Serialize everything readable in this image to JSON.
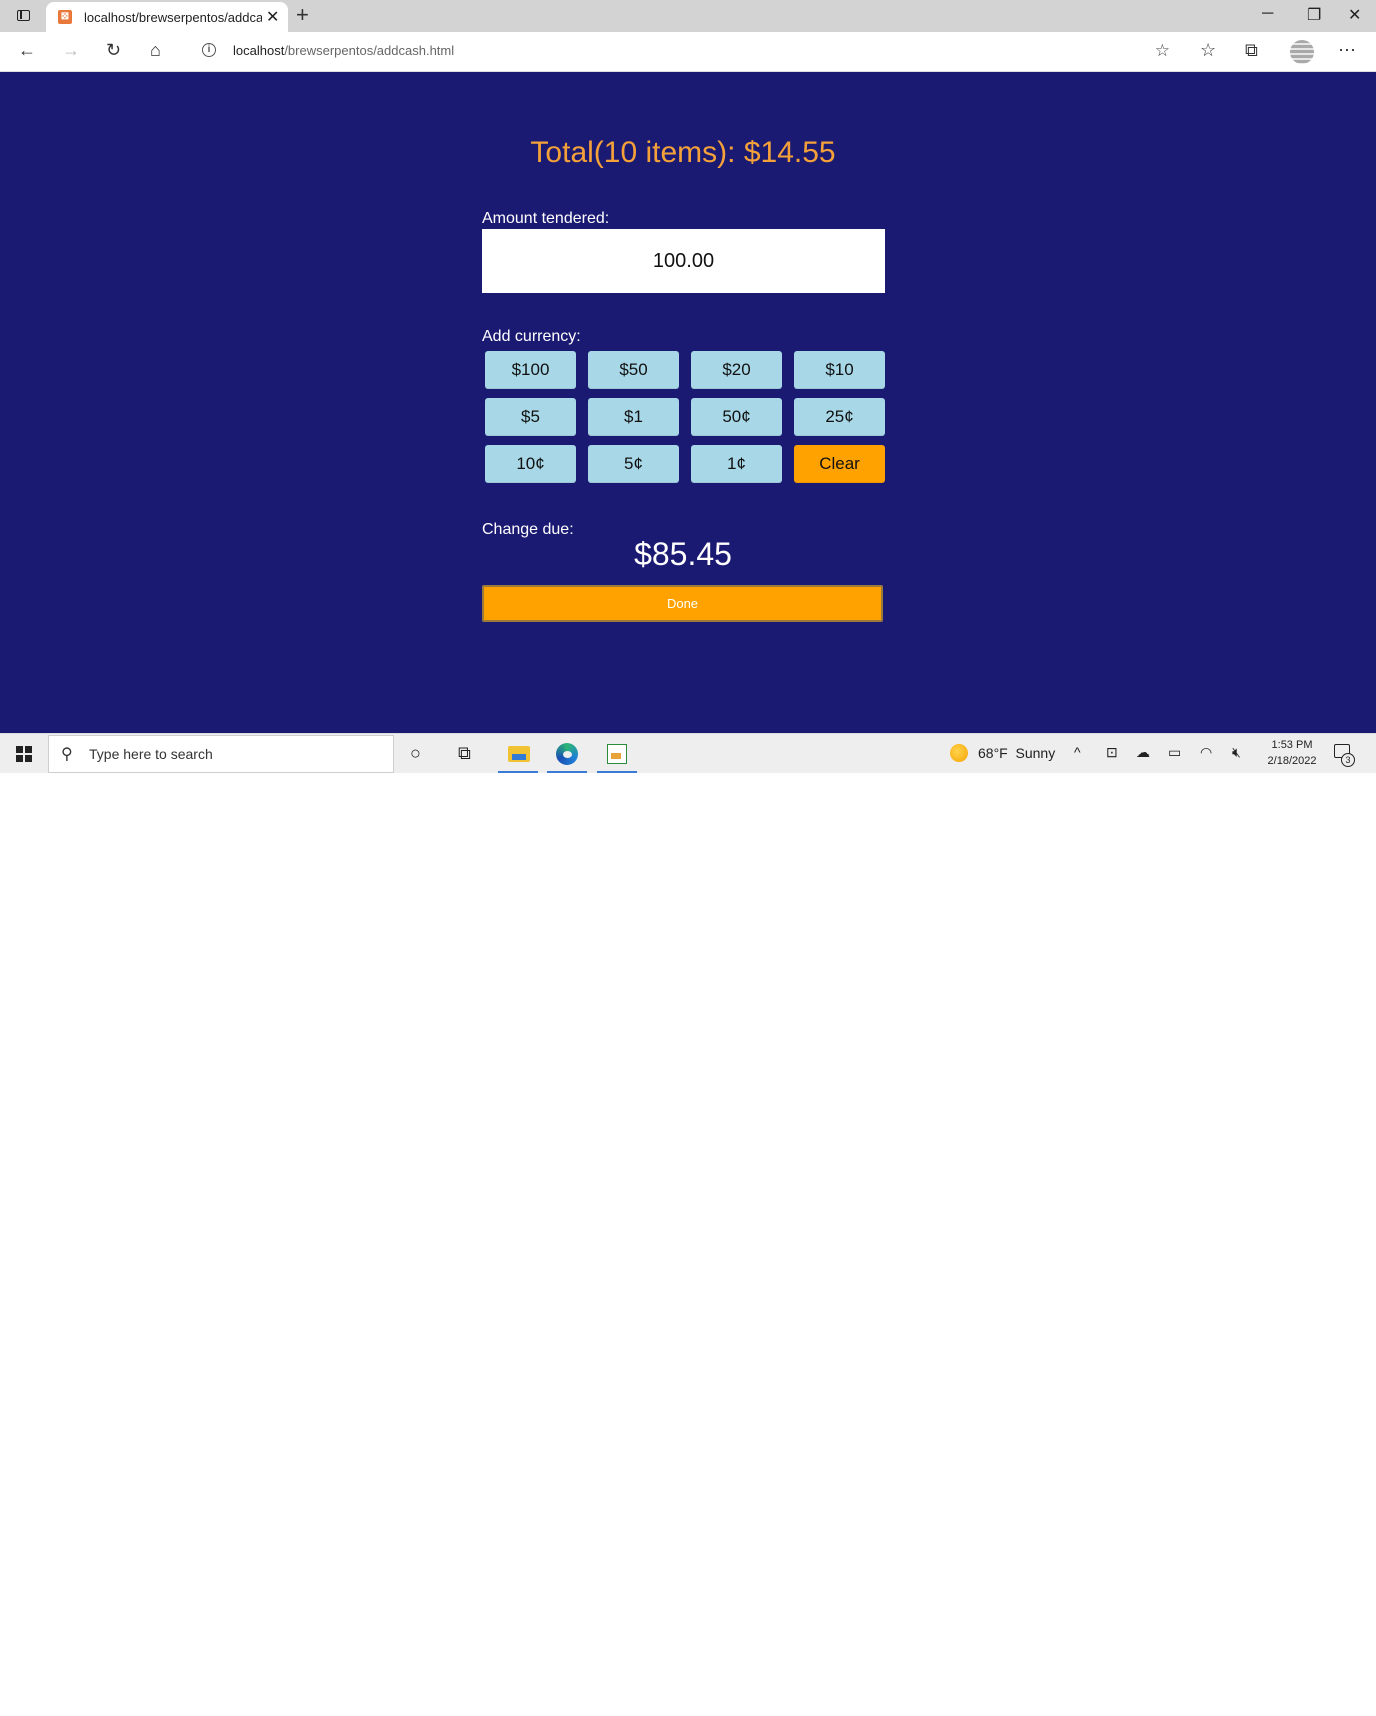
{
  "browser": {
    "tab_title": "localhost/brewserpentos/addcash.html",
    "url_host": "localhost",
    "url_path": "/brewserpentos/addcash.html",
    "favicon": "xampp-icon"
  },
  "page": {
    "total_text": "Total(10 items): $14.55",
    "amount_label": "Amount tendered:",
    "amount_value": "100.00",
    "currency_label": "Add currency:",
    "currency_buttons": [
      "$100",
      "$50",
      "$20",
      "$10",
      "$5",
      "$1",
      "50¢",
      "25¢",
      "10¢",
      "5¢",
      "1¢",
      "Clear"
    ],
    "change_label": "Change due:",
    "change_value": "$85.45",
    "done_label": "Done",
    "colors": {
      "background": "#1b1a73",
      "total_text": "#f5a13a",
      "currency_button": "#a8d8e8",
      "accent_button": "#ffa200"
    }
  },
  "taskbar": {
    "search_placeholder": "Type here to search",
    "weather_temp": "68°F",
    "weather_text": "Sunny",
    "time": "1:53 PM",
    "date": "2/18/2022",
    "notification_count": "3"
  }
}
